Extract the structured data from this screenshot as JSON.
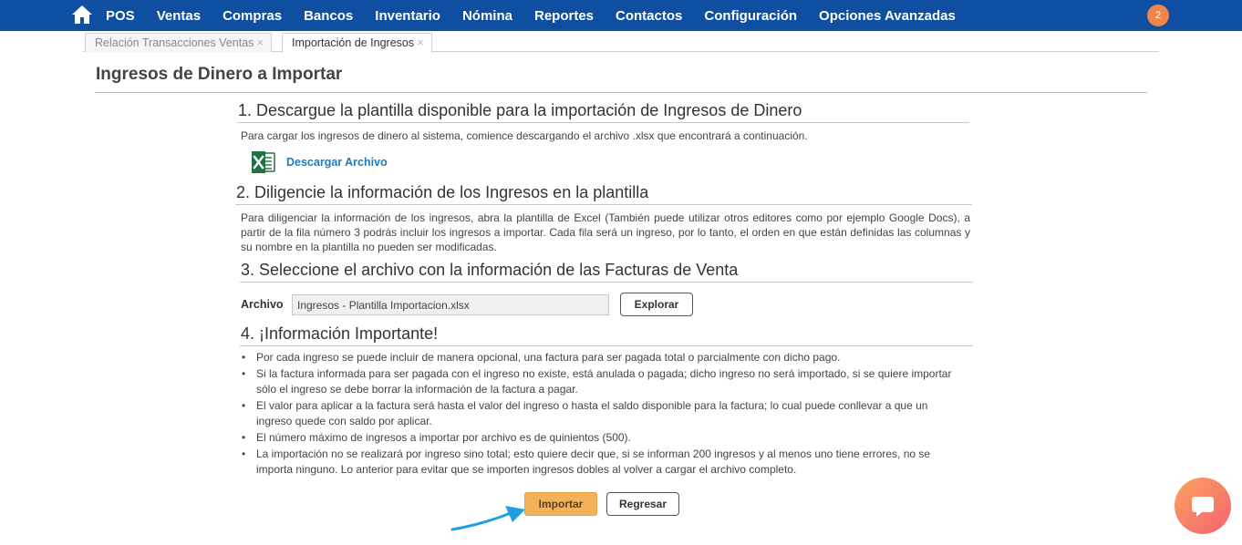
{
  "nav": {
    "items": [
      "POS",
      "Ventas",
      "Compras",
      "Bancos",
      "Inventario",
      "Nómina",
      "Reportes",
      "Contactos",
      "Configuración",
      "Opciones Avanzadas"
    ],
    "notifications": "2"
  },
  "tabs": [
    {
      "label": "Relación Transacciones Ventas",
      "close": "×"
    },
    {
      "label": "Importación de Ingresos",
      "close": "×"
    }
  ],
  "page": {
    "title": "Ingresos de Dinero a Importar"
  },
  "step1": {
    "heading": "1. Descargue la plantilla disponible para la importación de Ingresos de Dinero",
    "text": "Para cargar los ingresos de dinero al sistema, comience descargando el archivo .xlsx que encontrará a continuación.",
    "download_label": "Descargar Archivo"
  },
  "step2": {
    "heading": "2. Diligencie la información de los Ingresos en la plantilla",
    "text": "Para diligenciar la información de los ingresos, abra la plantilla de Excel (También puede utilizar otros editores como por ejemplo Google Docs), a partir de la fila número 3 podrás incluir los ingresos a importar. Cada fila será un ingreso, por lo tanto, el orden en que están definidas las columnas y su nombre en la plantilla no pueden ser modificadas."
  },
  "step3": {
    "heading": "3. Seleccione el archivo con la información de las Facturas de Venta",
    "file_label": "Archivo",
    "file_value": "Ingresos - Plantilla Importacion.xlsx",
    "browse_label": "Explorar"
  },
  "step4": {
    "heading": "4. ¡Información Importante!",
    "items": [
      "Por cada ingreso se puede incluir de manera opcional, una factura para ser pagada total o parcialmente con dicho pago.",
      "Si la factura informada para ser pagada con el ingreso no existe, está anulada o pagada; dicho ingreso no será importado, si se quiere importar sólo el ingreso se debe borrar la información de la factura a pagar.",
      "El valor para aplicar a la factura será hasta el valor del ingreso o hasta el saldo disponible para la factura; lo cual puede conllevar a que un ingreso quede con saldo por aplicar.",
      "El número máximo de ingresos a importar por archivo es de quinientos (500).",
      "La importación no se realizará por ingreso sino total; esto quiere decir que, si se informan 200 ingresos y al menos uno tiene errores, no se importa ninguno. Lo anterior para evitar que se importen ingresos dobles al volver a cargar el archivo completo."
    ]
  },
  "actions": {
    "import_label": "Importar",
    "back_label": "Regresar"
  },
  "colors": {
    "nav_bg": "#0f4fa2",
    "import_bg": "#f2b25a",
    "link": "#1a7ec0",
    "excel_green": "#1f7244",
    "arrow": "#1e9fe0"
  },
  "icons": {
    "home": "home-icon",
    "excel": "excel-file-icon",
    "chat": "chat-bubble-icon",
    "arrow": "pointer-arrow-icon"
  }
}
